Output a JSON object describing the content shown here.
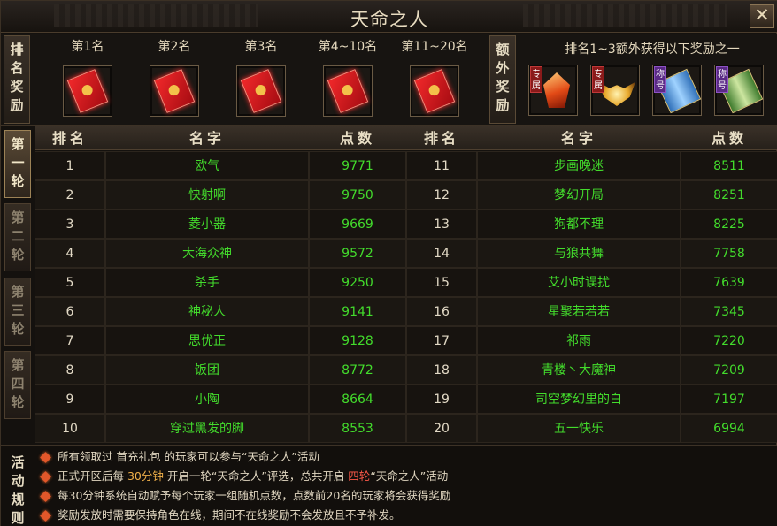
{
  "window": {
    "title": "天命之人",
    "close_label": "✕"
  },
  "rewards": {
    "rank_tab": [
      "排",
      "名",
      "奖",
      "励"
    ],
    "ranks": [
      {
        "label": "第1名",
        "icon": "red-envelope-icon"
      },
      {
        "label": "第2名",
        "icon": "red-envelope-icon"
      },
      {
        "label": "第3名",
        "icon": "red-envelope-icon"
      },
      {
        "label": "第4~10名",
        "icon": "red-envelope-icon"
      },
      {
        "label": "第11~20名",
        "icon": "red-envelope-icon"
      }
    ],
    "extra_tab": [
      "额",
      "外",
      "奖",
      "励"
    ],
    "extra_caption": "排名1~3额外获得以下奖励之一",
    "extras": [
      {
        "badge": "专属",
        "icon": "flame-crystal-icon"
      },
      {
        "badge": "专属",
        "icon": "golden-wings-icon"
      },
      {
        "badge": "称号",
        "icon": "blue-scroll-icon"
      },
      {
        "badge": "称号",
        "icon": "green-scroll-icon"
      }
    ]
  },
  "rounds": [
    {
      "chars": [
        "第",
        "一",
        "轮"
      ],
      "active": true
    },
    {
      "chars": [
        "第",
        "二",
        "轮"
      ],
      "active": false
    },
    {
      "chars": [
        "第",
        "三",
        "轮"
      ],
      "active": false
    },
    {
      "chars": [
        "第",
        "四",
        "轮"
      ],
      "active": false
    }
  ],
  "table": {
    "headers": {
      "rank": "排名",
      "name": "名字",
      "score": "点数"
    },
    "rows": [
      {
        "rank": "1",
        "name": "欧气",
        "score": "9771"
      },
      {
        "rank": "2",
        "name": "快射啊",
        "score": "9750"
      },
      {
        "rank": "3",
        "name": "菱小器",
        "score": "9669"
      },
      {
        "rank": "4",
        "name": "大海众神",
        "score": "9572"
      },
      {
        "rank": "5",
        "name": "杀手",
        "score": "9250"
      },
      {
        "rank": "6",
        "name": "神秘人",
        "score": "9141"
      },
      {
        "rank": "7",
        "name": "思优正",
        "score": "9128"
      },
      {
        "rank": "8",
        "name": "饭团",
        "score": "8772"
      },
      {
        "rank": "9",
        "name": "小陶",
        "score": "8664"
      },
      {
        "rank": "10",
        "name": "穿过黑发的脚",
        "score": "8553"
      },
      {
        "rank": "11",
        "name": "步画晚迷",
        "score": "8511"
      },
      {
        "rank": "12",
        "name": "梦幻开局",
        "score": "8251"
      },
      {
        "rank": "13",
        "name": "狗都不理",
        "score": "8225"
      },
      {
        "rank": "14",
        "name": "与狼共舞",
        "score": "7758"
      },
      {
        "rank": "15",
        "name": "艾小时误扰",
        "score": "7639"
      },
      {
        "rank": "16",
        "name": "星聚若若若",
        "score": "7345"
      },
      {
        "rank": "17",
        "name": "祁雨",
        "score": "7220"
      },
      {
        "rank": "18",
        "name": "青楼丶大魔神",
        "score": "7209"
      },
      {
        "rank": "19",
        "name": "司空梦幻里的白",
        "score": "7197"
      },
      {
        "rank": "20",
        "name": "五一快乐",
        "score": "6994"
      }
    ]
  },
  "rules": {
    "tab": [
      "活",
      "动",
      "规",
      "则"
    ],
    "lines": [
      [
        {
          "t": "所有领取过 首充礼包 的玩家可以参与“天命之人”活动"
        }
      ],
      [
        {
          "t": "正式开区后每 "
        },
        {
          "t": "30分钟",
          "c": "hl"
        },
        {
          "t": " 开启一轮“天命之人”评选，总共开启 "
        },
        {
          "t": "四轮",
          "c": "red"
        },
        {
          "t": "“天命之人”活动"
        }
      ],
      [
        {
          "t": "每30分钟系统自动赋予每个玩家一组随机点数，点数前20名的玩家将会获得奖励"
        }
      ],
      [
        {
          "t": "奖励发放时需要保持角色在线，期间不在线奖励不会发放且不予补发。"
        }
      ]
    ]
  },
  "colors": {
    "name_green": "#43dc2c",
    "accent_orange": "#f0b04a",
    "accent_red": "#ff5a4a"
  }
}
